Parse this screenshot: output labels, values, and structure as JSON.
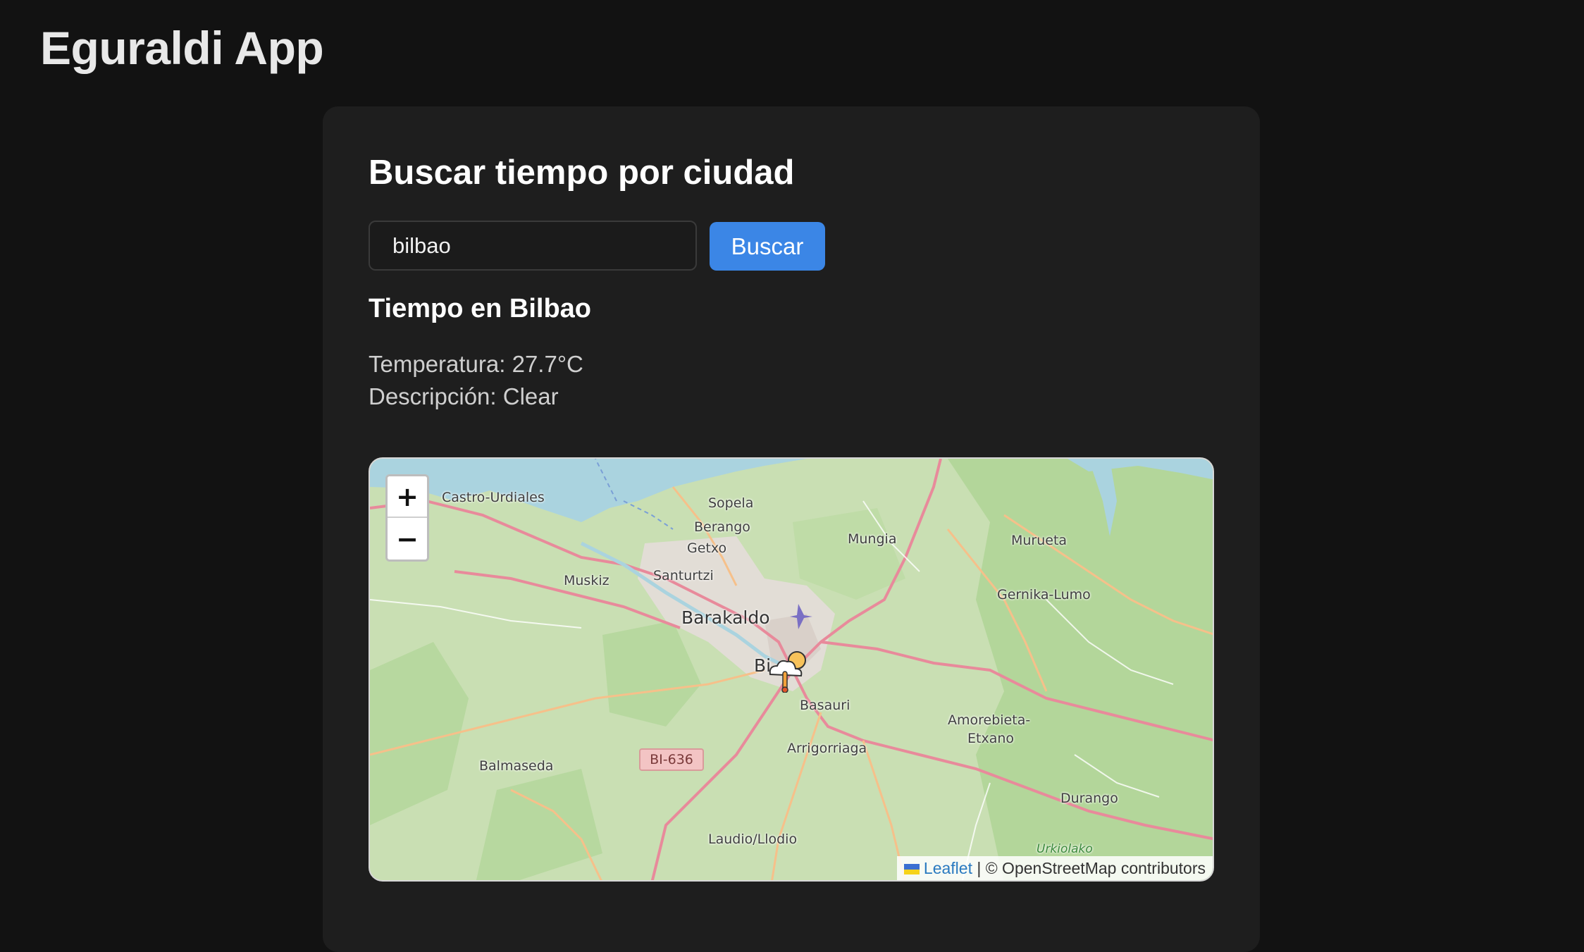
{
  "app": {
    "title": "Eguraldi App"
  },
  "search": {
    "heading": "Buscar tiempo por ciudad",
    "input_value": "bilbao",
    "button_label": "Buscar"
  },
  "result": {
    "title": "Tiempo en Bilbao",
    "temperature": "Temperatura: 27.7°C",
    "description": "Descripción: Clear"
  },
  "map": {
    "zoom_in": "+",
    "zoom_out": "−",
    "road_shield": "BI-636",
    "places": {
      "castro_urdiales": "Castro-Urdiales",
      "sopela": "Sopela",
      "berango": "Berango",
      "getxo": "Getxo",
      "mungia": "Mungia",
      "murueta": "Murueta",
      "muskiz": "Muskiz",
      "santurtzi": "Santurtzi",
      "gernika_lumo": "Gernika-Lumo",
      "barakaldo": "Barakaldo",
      "bilbao": "Bi",
      "basauri": "Basauri",
      "amorebieta": "Amorebieta-",
      "etxano": "Etxano",
      "balmaseda": "Balmaseda",
      "arrigorriaga": "Arrigorriaga",
      "durango": "Durango",
      "laudio": "Laudio/Llodio",
      "urkiolako": "Urkiolako"
    },
    "attribution": {
      "leaflet": "Leaflet",
      "separator": " | © OpenStreetMap contributors"
    },
    "marker_icon": "weather-cloud-sun-thermometer-icon",
    "colors": {
      "water": "#aad3df",
      "land": "#c9dfb3",
      "forest": "#a9cf8f",
      "urban": "#e0dcd6",
      "motorway": "#e88a9b",
      "primary": "#f6c08a",
      "accent": "#3b86e6"
    }
  }
}
